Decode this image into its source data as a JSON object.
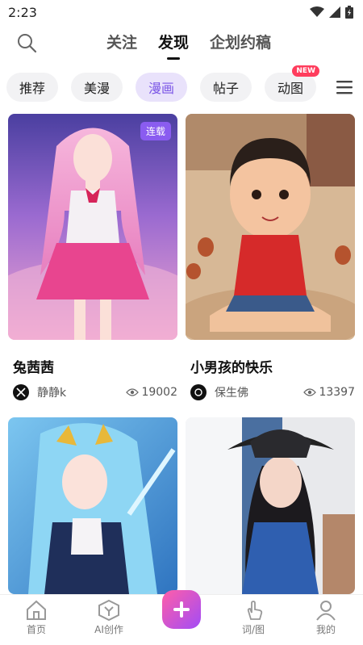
{
  "status_bar": {
    "time": "2:23"
  },
  "header": {
    "tabs": [
      {
        "label": "关注",
        "active": false
      },
      {
        "label": "发现",
        "active": true
      },
      {
        "label": "企划约稿",
        "active": false
      }
    ]
  },
  "categories": [
    {
      "label": "推荐",
      "active": false
    },
    {
      "label": "美漫",
      "active": false
    },
    {
      "label": "漫画",
      "active": true
    },
    {
      "label": "帖子",
      "active": false
    },
    {
      "label": "动图",
      "active": false,
      "badge": "NEW"
    }
  ],
  "cards": [
    {
      "title": "兔茜茜",
      "tag": "连载",
      "author": "静静k",
      "views": "19002"
    },
    {
      "title": "小男孩的快乐",
      "author": "保生佛",
      "views": "13397"
    },
    {
      "title": "",
      "author": "",
      "views": ""
    },
    {
      "title": "",
      "author": "",
      "views": ""
    }
  ],
  "bottom_nav": [
    {
      "label": "首页",
      "icon": "home-icon"
    },
    {
      "label": "AI创作",
      "icon": "ai-create-icon"
    },
    {
      "label": "",
      "icon": "plus-icon"
    },
    {
      "label": "词/图",
      "icon": "touch-icon"
    },
    {
      "label": "我的",
      "icon": "profile-icon"
    }
  ],
  "colors": {
    "accent": "#8a5cf0",
    "chip_active_bg": "#e9e2fb",
    "badge": "#ff3d5d"
  }
}
